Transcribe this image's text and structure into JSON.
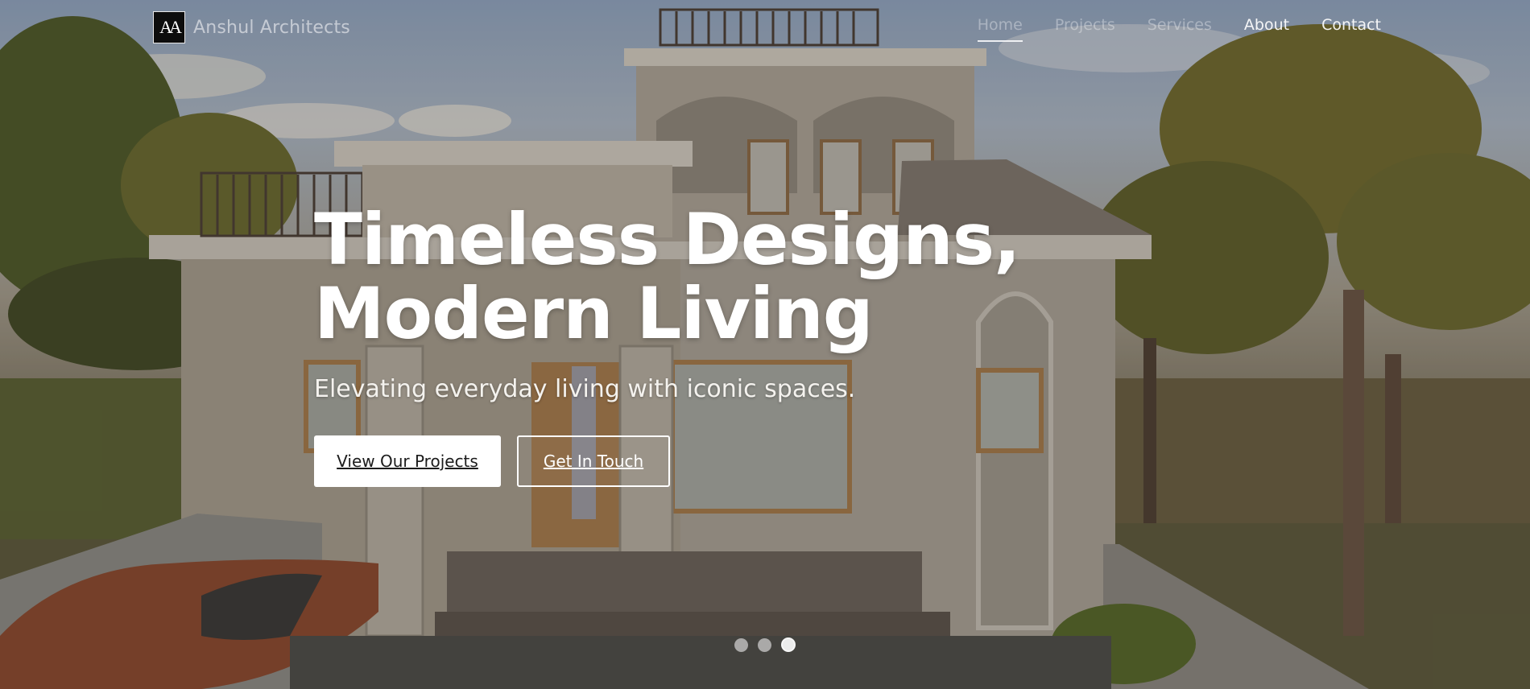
{
  "brand": {
    "logo_text": "AA",
    "name": "Anshul Architects"
  },
  "nav": {
    "items": [
      {
        "label": "Home",
        "active": true
      },
      {
        "label": "Projects",
        "active": false
      },
      {
        "label": "Services",
        "active": false
      },
      {
        "label": "About",
        "active": false
      },
      {
        "label": "Contact",
        "active": false
      }
    ]
  },
  "hero": {
    "headline_line1": "Timeless Designs,",
    "headline_line2": "Modern Living",
    "subheadline": "Elevating everyday living with iconic spaces.",
    "primary_button": "View Our Projects",
    "secondary_button": "Get In Touch",
    "slides": {
      "count": 3,
      "active_index": 2
    }
  },
  "colors": {
    "text": "#ffffff",
    "button_bg": "#ffffff",
    "button_text": "#1c1c1c"
  }
}
